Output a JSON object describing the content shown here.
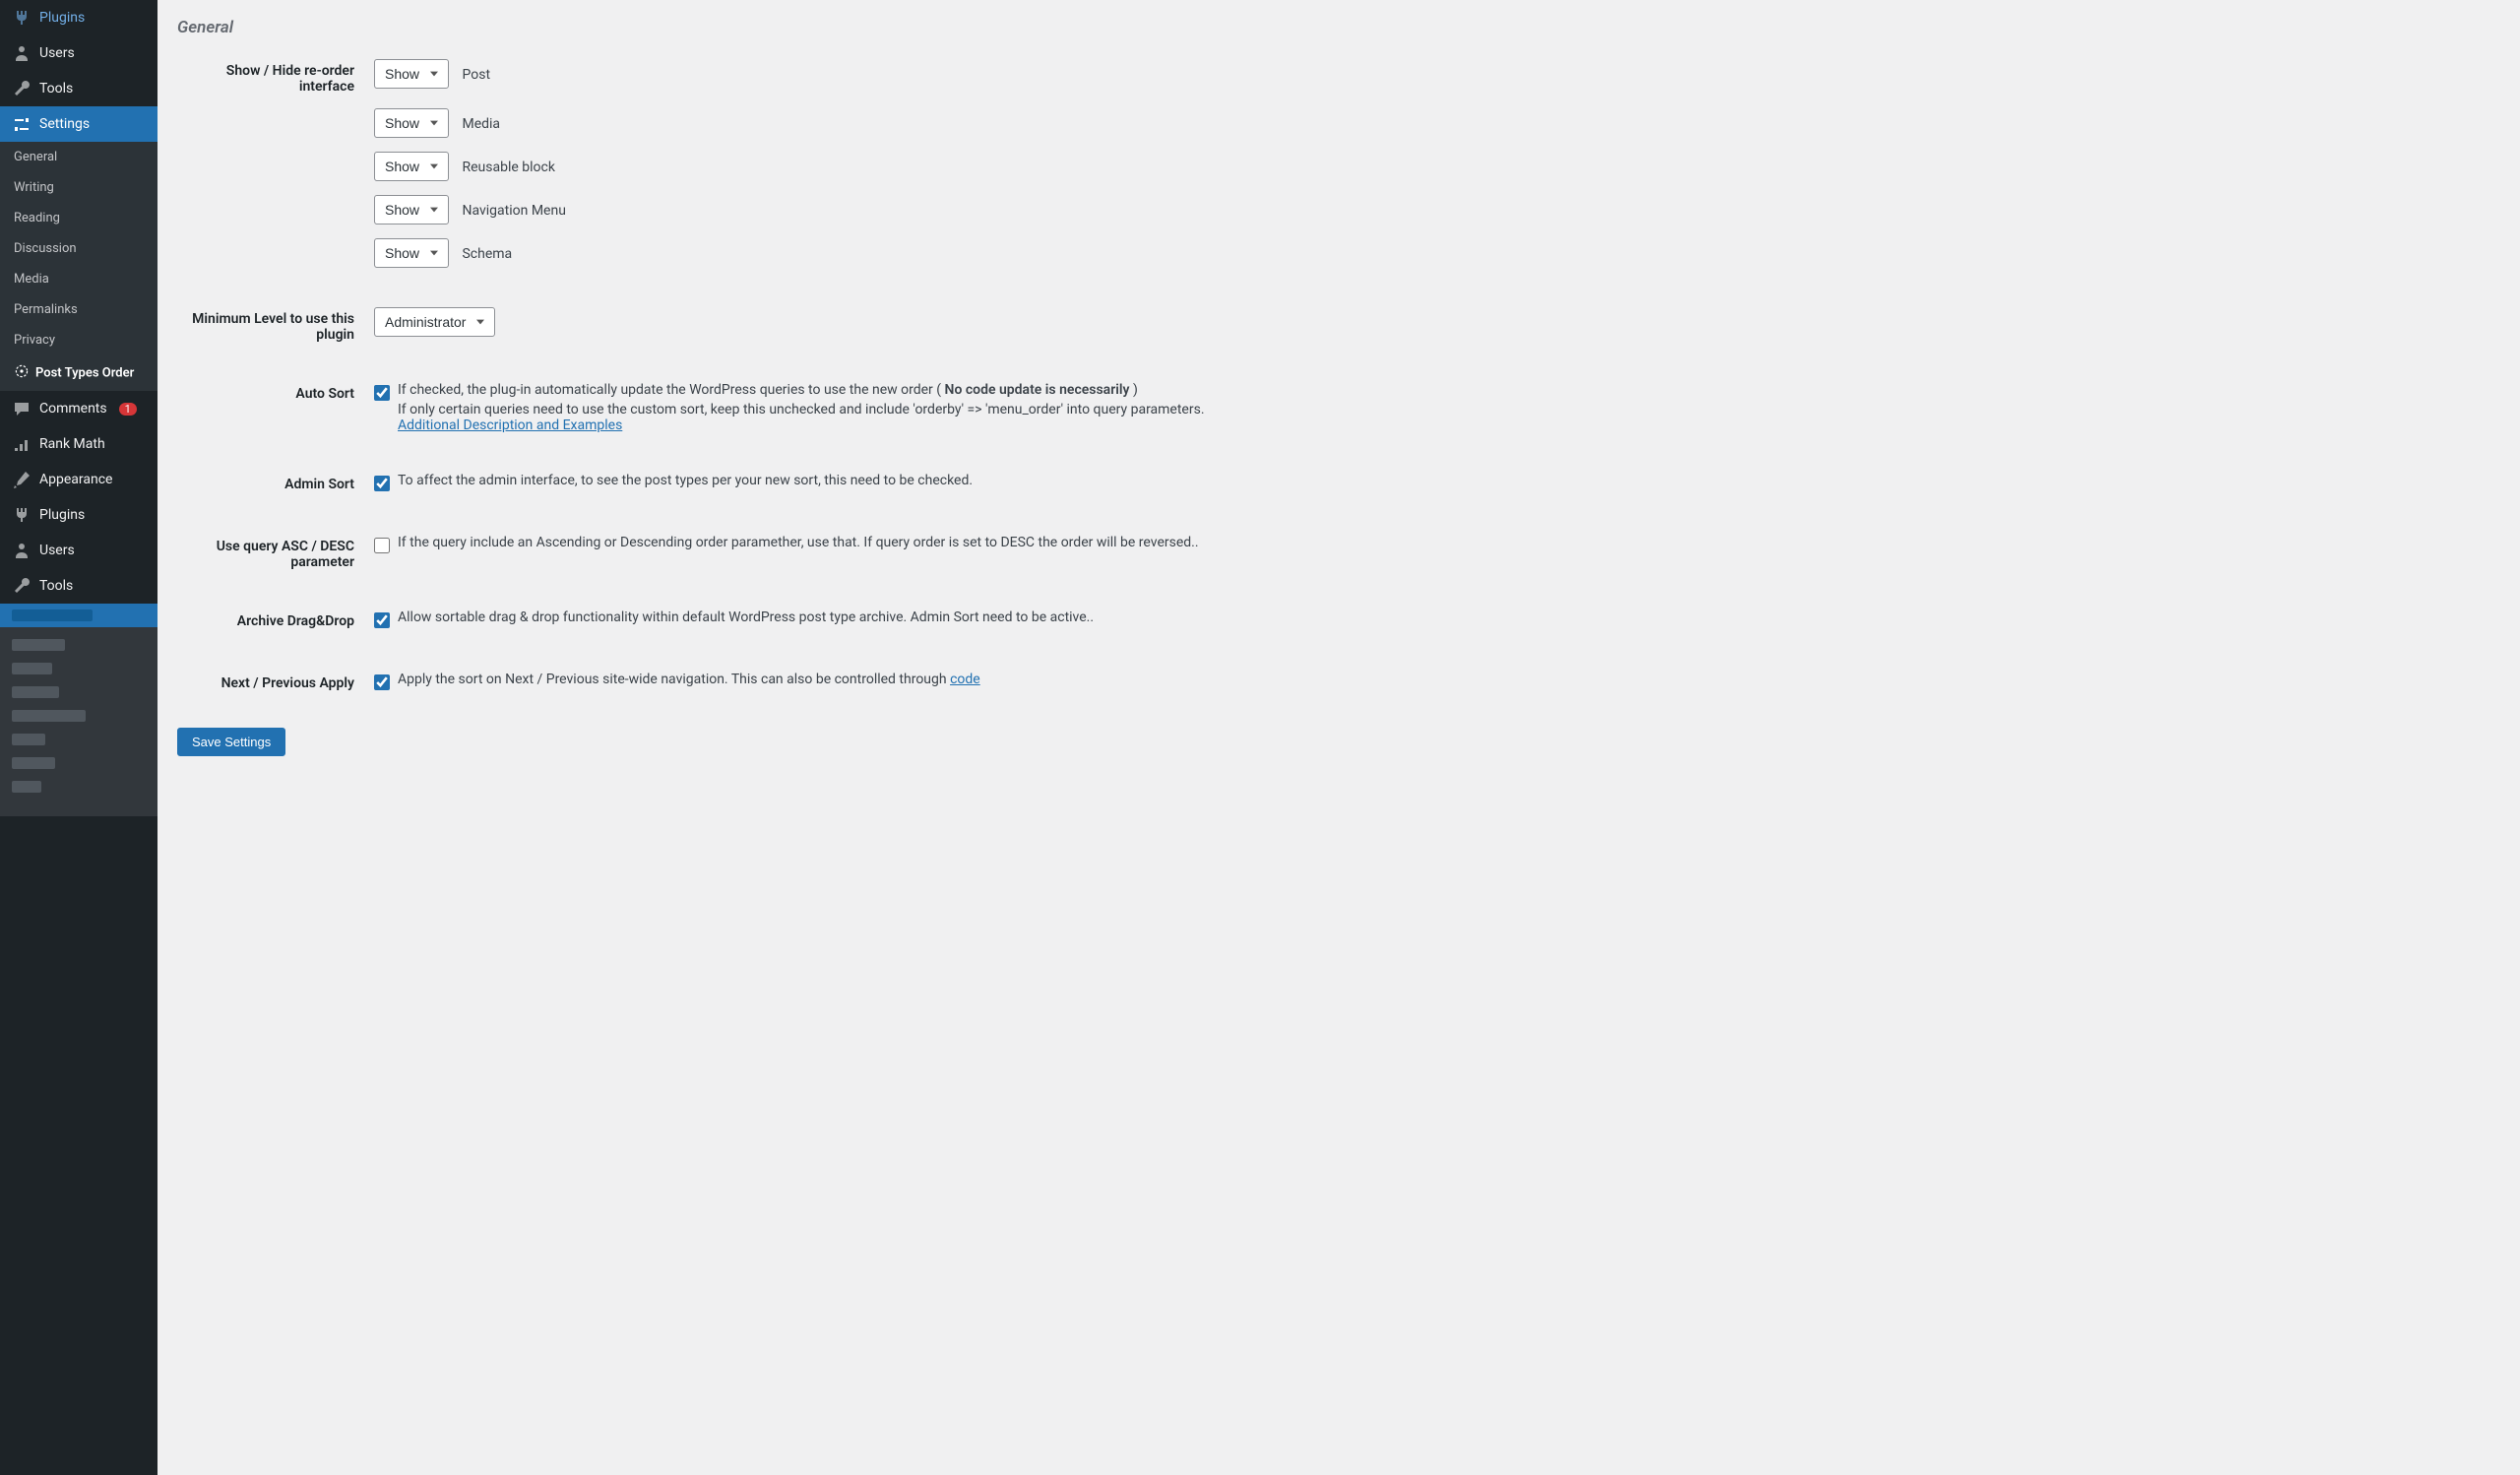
{
  "sidebar": {
    "plugins_top": "Plugins",
    "users_top": "Users",
    "tools_top": "Tools",
    "settings": "Settings",
    "submenu": {
      "general": "General",
      "writing": "Writing",
      "reading": "Reading",
      "discussion": "Discussion",
      "media": "Media",
      "permalinks": "Permalinks",
      "privacy": "Privacy",
      "pto": "Post Types Order"
    },
    "comments": "Comments",
    "comments_count": "1",
    "rankmath": "Rank Math",
    "appearance": "Appearance",
    "plugins": "Plugins",
    "users": "Users",
    "tools": "Tools"
  },
  "page": {
    "heading": "General",
    "row_show_hide": "Show / Hide re-order interface",
    "types": {
      "post": "Post",
      "media": "Media",
      "reusable": "Reusable block",
      "nav": "Navigation Menu",
      "schema": "Schema"
    },
    "select_show": "Show",
    "row_min_level": "Minimum Level to use this plugin",
    "level_value": "Administrator",
    "row_auto_sort": "Auto Sort",
    "auto_sort_text_pre": "If checked, the plug-in automatically update the WordPress queries to use the new order ( ",
    "auto_sort_bold": "No code update is necessarily",
    "auto_sort_text_post": " )",
    "auto_sort_desc": "If only certain queries need to use the custom sort, keep this unchecked and include 'orderby' => 'menu_order' into query parameters.",
    "auto_sort_link": "Additional Description and Examples",
    "row_admin_sort": "Admin Sort",
    "admin_sort_text": "To affect the admin interface, to see the post types per your new sort, this need to be checked.",
    "row_asc_desc": "Use query ASC / DESC parameter",
    "asc_desc_text": "If the query include an Ascending or Descending order paramether, use that. If query order is set to DESC the order will be reversed..",
    "row_archive": "Archive Drag&Drop",
    "archive_text": "Allow sortable drag & drop functionality within default WordPress post type archive. Admin Sort need to be active..",
    "row_nextprev": "Next / Previous Apply",
    "nextprev_text": "Apply the sort on Next / Previous site-wide navigation. This can also be controlled through ",
    "nextprev_link": "code",
    "save": "Save Settings"
  }
}
